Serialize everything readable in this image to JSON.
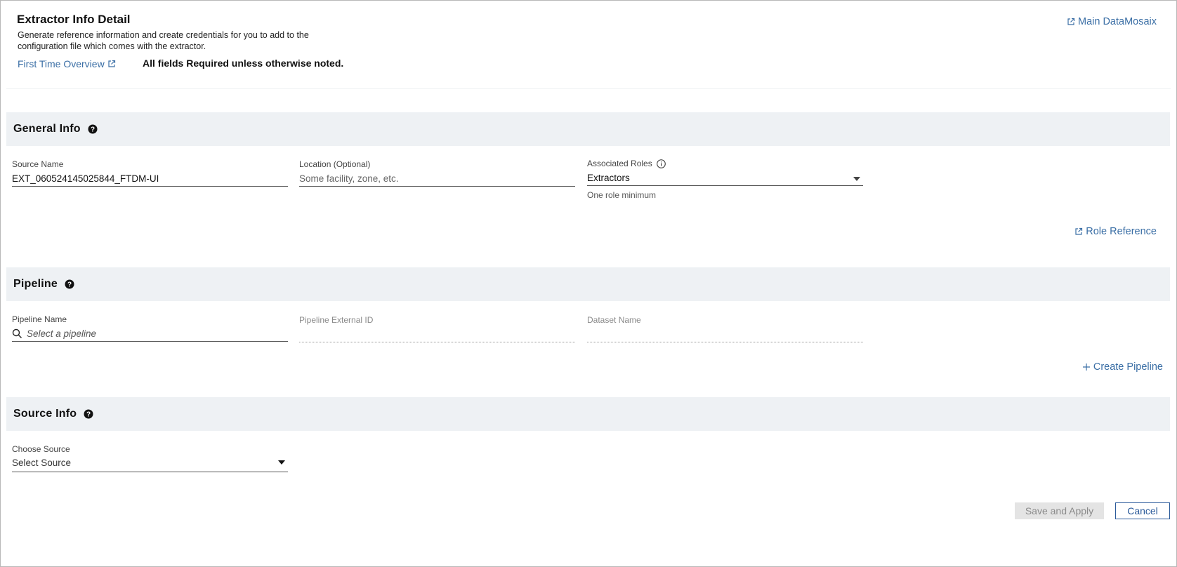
{
  "header": {
    "title": "Extractor Info Detail",
    "subtitle": "Generate reference information and create credentials for you to add to the configuration file which comes with the extractor.",
    "first_time_link": "First Time Overview",
    "required_note": "All fields Required unless otherwise noted.",
    "main_link": "Main DataMosaix"
  },
  "general_info": {
    "title": "General Info",
    "source_name": {
      "label": "Source Name",
      "value": "EXT_060524145025844_FTDM-UI"
    },
    "location": {
      "label": "Location (Optional)",
      "placeholder": "Some facility, zone, etc."
    },
    "roles": {
      "label": "Associated Roles",
      "value": "Extractors",
      "hint": "One role minimum"
    },
    "role_reference_link": "Role Reference"
  },
  "pipeline": {
    "title": "Pipeline",
    "name": {
      "label": "Pipeline Name",
      "placeholder": "Select a pipeline"
    },
    "external_id": {
      "label": "Pipeline External ID"
    },
    "dataset": {
      "label": "Dataset Name"
    },
    "create_link": "Create Pipeline"
  },
  "source_info": {
    "title": "Source Info",
    "choose_source": {
      "label": "Choose Source",
      "value": "Select Source"
    }
  },
  "actions": {
    "save_label": "Save and Apply",
    "cancel_label": "Cancel"
  },
  "colors": {
    "link": "#3a6ea5",
    "section_bg": "#eef1f4",
    "cancel_border": "#2a5a9a",
    "disabled_bg": "#e4e4e4"
  }
}
